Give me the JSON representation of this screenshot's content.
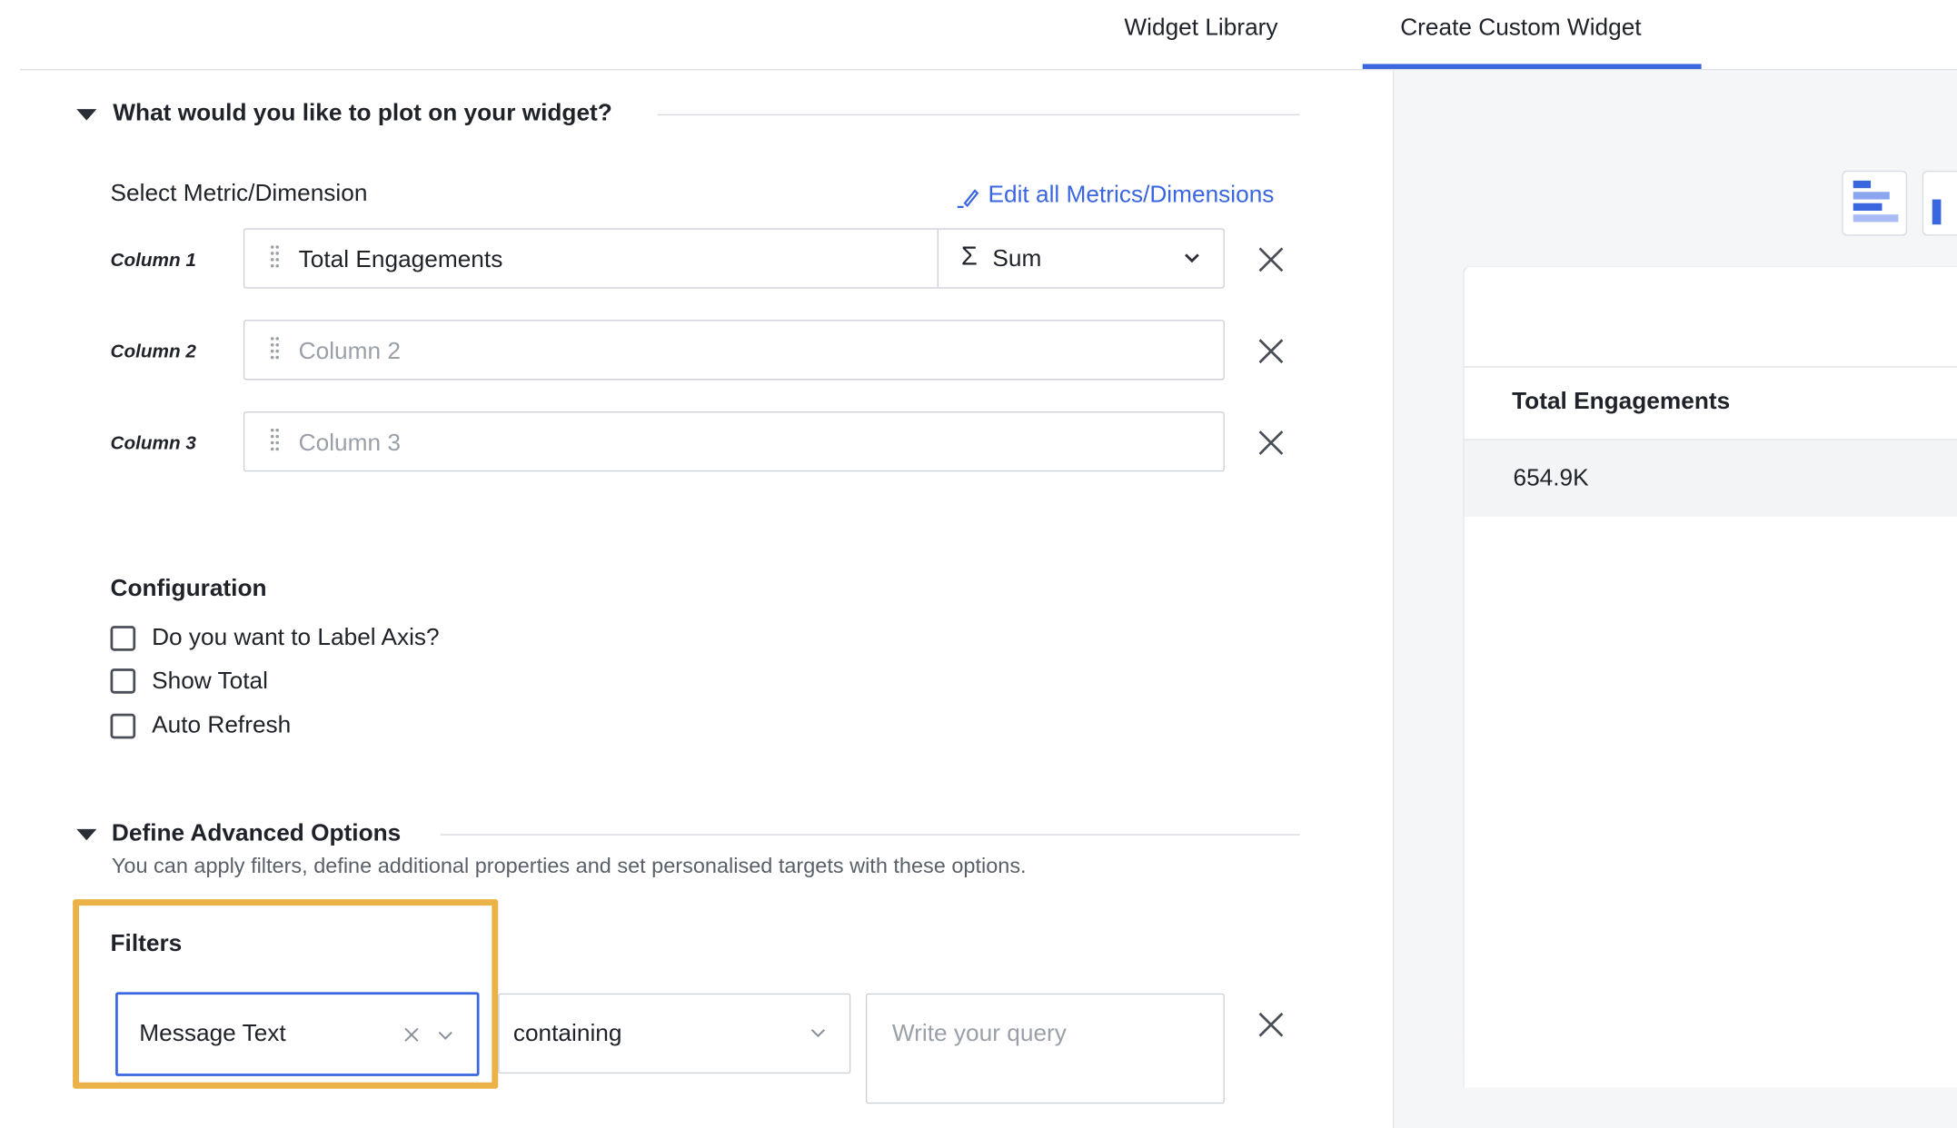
{
  "tabs": [
    {
      "label": "Widget Library",
      "active": false
    },
    {
      "label": "Create Custom Widget",
      "active": true
    }
  ],
  "accent_color": "#3a66e0",
  "highlight_color": "#eab247",
  "plot_section": {
    "title": "What would you like to plot on your widget?",
    "select_label": "Select Metric/Dimension",
    "edit_link": "Edit all Metrics/Dimensions",
    "columns": [
      {
        "label": "Column 1",
        "value": "Total Engagements",
        "aggregation": "Sum",
        "aggregation_symbol": "Σ"
      },
      {
        "label": "Column 2",
        "placeholder": "Column 2"
      },
      {
        "label": "Column 3",
        "placeholder": "Column 3"
      }
    ]
  },
  "configuration": {
    "title": "Configuration",
    "options": [
      {
        "label": "Do you want to Label Axis?",
        "checked": false
      },
      {
        "label": "Show Total",
        "checked": false
      },
      {
        "label": "Auto Refresh",
        "checked": false
      }
    ]
  },
  "advanced": {
    "title": "Define Advanced Options",
    "description": "You can apply filters, define additional properties and set personalised targets with these options.",
    "filters_title": "Filters",
    "filter_field": "Message Text",
    "filter_operator": "containing",
    "query_placeholder": "Write your query"
  },
  "preview": {
    "column_header": "Total Engagements",
    "value": "654.9K",
    "icons": [
      "bar-chart-icon",
      "column-chart-icon"
    ]
  }
}
